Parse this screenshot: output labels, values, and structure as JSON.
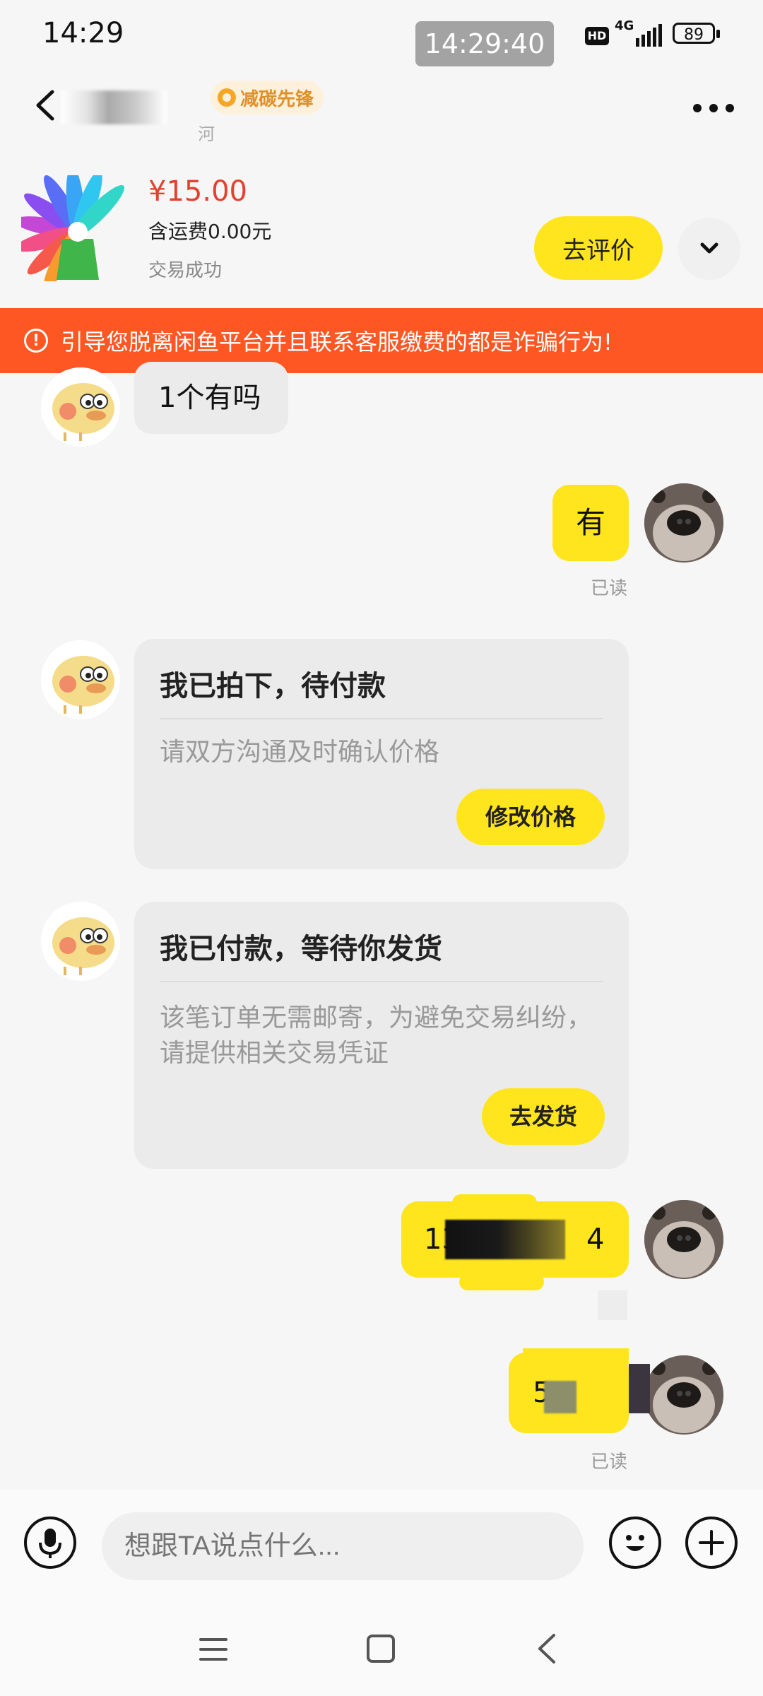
{
  "status_bar": {
    "time": "14:29",
    "clock_overlay": "14:29:40",
    "hd": "HD",
    "network": "4G",
    "battery": "89"
  },
  "header": {
    "badge": "减碳先锋",
    "subtitle_fragment": "河"
  },
  "product": {
    "price": "¥15.00",
    "shipping": "含运费0.00元",
    "status": "交易成功",
    "review_button": "去评价"
  },
  "warning": {
    "text": "引导您脱离闲鱼平台并且联系客服缴费的都是诈骗行为!"
  },
  "messages": {
    "m1": "1个有吗",
    "m2": "有",
    "m2_status": "已读",
    "card1": {
      "title": "我已拍下，待付款",
      "desc": "请双方沟通及时确认价格",
      "button": "修改价格"
    },
    "card2": {
      "title": "我已付款，等待你发货",
      "desc": "该笔订单无需邮寄，为避免交易纠纷，请提供相关交易凭证",
      "button": "去发货"
    },
    "m3_prefix": "13",
    "m3_suffix": "4",
    "m4_prefix": "5",
    "m4_status": "已读"
  },
  "input": {
    "placeholder": "想跟TA说点什么..."
  },
  "icons": {
    "back": "back-arrow-icon",
    "more": "more-dots-icon",
    "expand": "chevron-down-icon",
    "mic": "microphone-icon",
    "emoji": "emoji-icon",
    "plus": "plus-icon"
  },
  "colors": {
    "accent": "#ffe51e",
    "warning": "#fe5724",
    "price": "#e3412d"
  }
}
